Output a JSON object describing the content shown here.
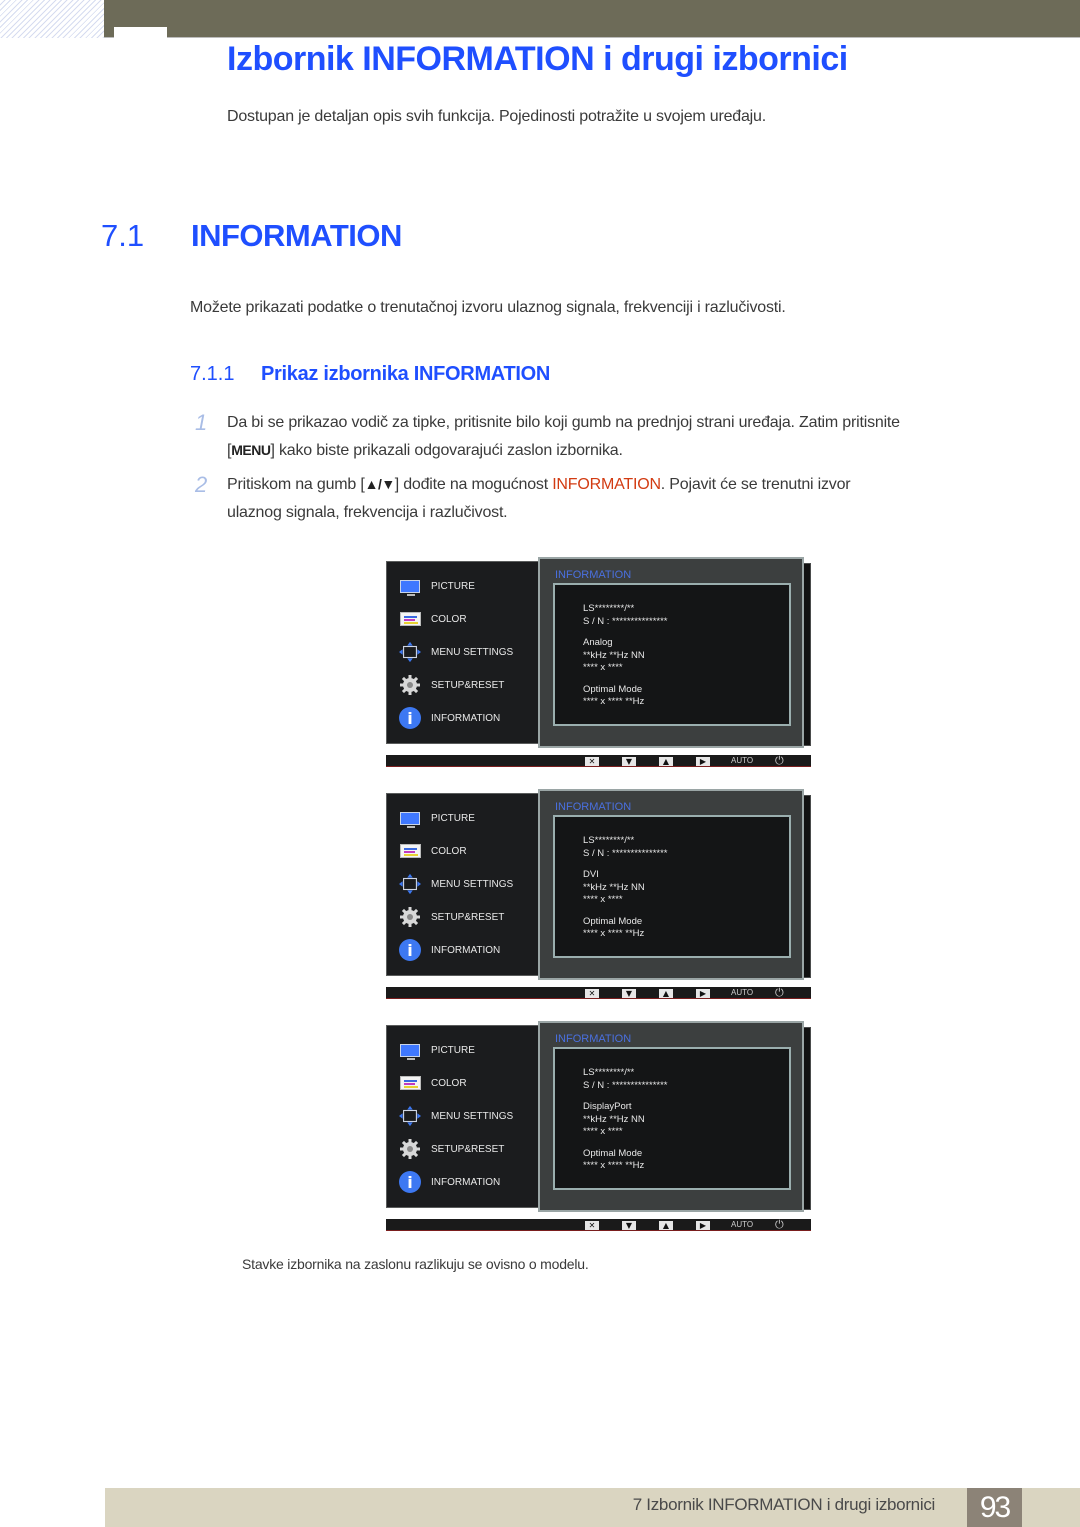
{
  "header": {
    "chapter_title": "Izbornik INFORMATION i drugi izbornici",
    "intro": "Dostupan je detaljan opis svih funkcija. Pojedinosti potražite u svojem uređaju."
  },
  "section": {
    "number": "7.1",
    "title": "INFORMATION",
    "description": "Možete prikazati podatke o trenutačnoj izvoru ulaznog signala, frekvenciji i razlučivosti."
  },
  "subsection": {
    "number": "7.1.1",
    "title": "Prikaz izbornika INFORMATION"
  },
  "steps": [
    {
      "number": "1",
      "line1": "Da bi se prikazao vodič za tipke, pritisnite bilo koji gumb na prednjoj strani uređaja. Zatim pritisnite",
      "line2_open": "[",
      "line2_key": "MENU",
      "line2_rest": "] kako biste prikazali odgovarajući zaslon izbornika."
    },
    {
      "number": "2",
      "line1_pre": "Pritiskom na gumb [",
      "line1_keys": "▲/▼",
      "line1_mid": "] dođite na mogućnost ",
      "line1_highlight": "INFORMATION",
      "line1_post": ". Pojavit će se trenutni izvor",
      "line2": "ulaznog signala, frekvencija i razlučivost."
    }
  ],
  "osd_menu": {
    "items": [
      {
        "label": "PICTURE",
        "icon": "monitor-icon"
      },
      {
        "label": "COLOR",
        "icon": "color-bars-icon"
      },
      {
        "label": "MENU SETTINGS",
        "icon": "arrows-frame-icon"
      },
      {
        "label": "SETUP&RESET",
        "icon": "gear-icon"
      },
      {
        "label": "INFORMATION",
        "icon": "info-icon"
      }
    ],
    "panel_title": "INFORMATION",
    "model": "LS********/**",
    "serial": "S / N : ***************",
    "frequency": "**kHz **Hz NN",
    "resolution": "**** x ****",
    "optimal_label": "Optimal Mode",
    "optimal_value": "**** x **** **Hz",
    "buttons": {
      "close": "✕",
      "down": "▼",
      "up": "▲",
      "enter": "▶",
      "auto": "AUTO",
      "power": "⏻"
    },
    "screens": [
      {
        "source": "Analog"
      },
      {
        "source": "DVI"
      },
      {
        "source": "DisplayPort"
      }
    ]
  },
  "note": "Stavke izbornika na zaslonu razlikuju se ovisno o modelu.",
  "footer": {
    "chapter_label": "7 Izbornik INFORMATION i drugi izbornici",
    "page_number": "93"
  },
  "colors": {
    "heading_blue": "#1f4fff",
    "highlight_red": "#d23b12",
    "header_band": "#6d6b58",
    "footer_band": "#dad5c1",
    "page_badge": "#8c8377"
  }
}
